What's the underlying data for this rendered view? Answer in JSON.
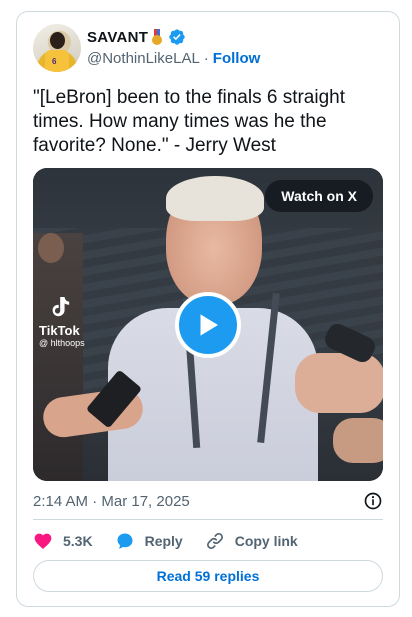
{
  "author": {
    "display_name": "SAVANT",
    "badge_icon": "medal-icon",
    "verified_icon": "verified-badge-icon",
    "handle": "@NothinLikeLAL",
    "separator": "·",
    "follow_label": "Follow"
  },
  "tweet": {
    "text": "\"[LeBron] been to the finals 6 straight times. How many times was he the favorite? None.\" - Jerry West",
    "timestamp": "2:14 AM · Mar 17, 2025"
  },
  "media": {
    "watch_label": "Watch on X",
    "watermark_brand": "TikTok",
    "watermark_user": "@ hlthoops",
    "play_icon": "play-icon"
  },
  "actions": {
    "like_count": "5.3K",
    "reply_label": "Reply",
    "copy_link_label": "Copy link",
    "read_replies_label": "Read 59 replies"
  },
  "colors": {
    "accent": "#1d9bf0",
    "link": "#006fd6",
    "like": "#f91880",
    "muted": "#536471"
  }
}
